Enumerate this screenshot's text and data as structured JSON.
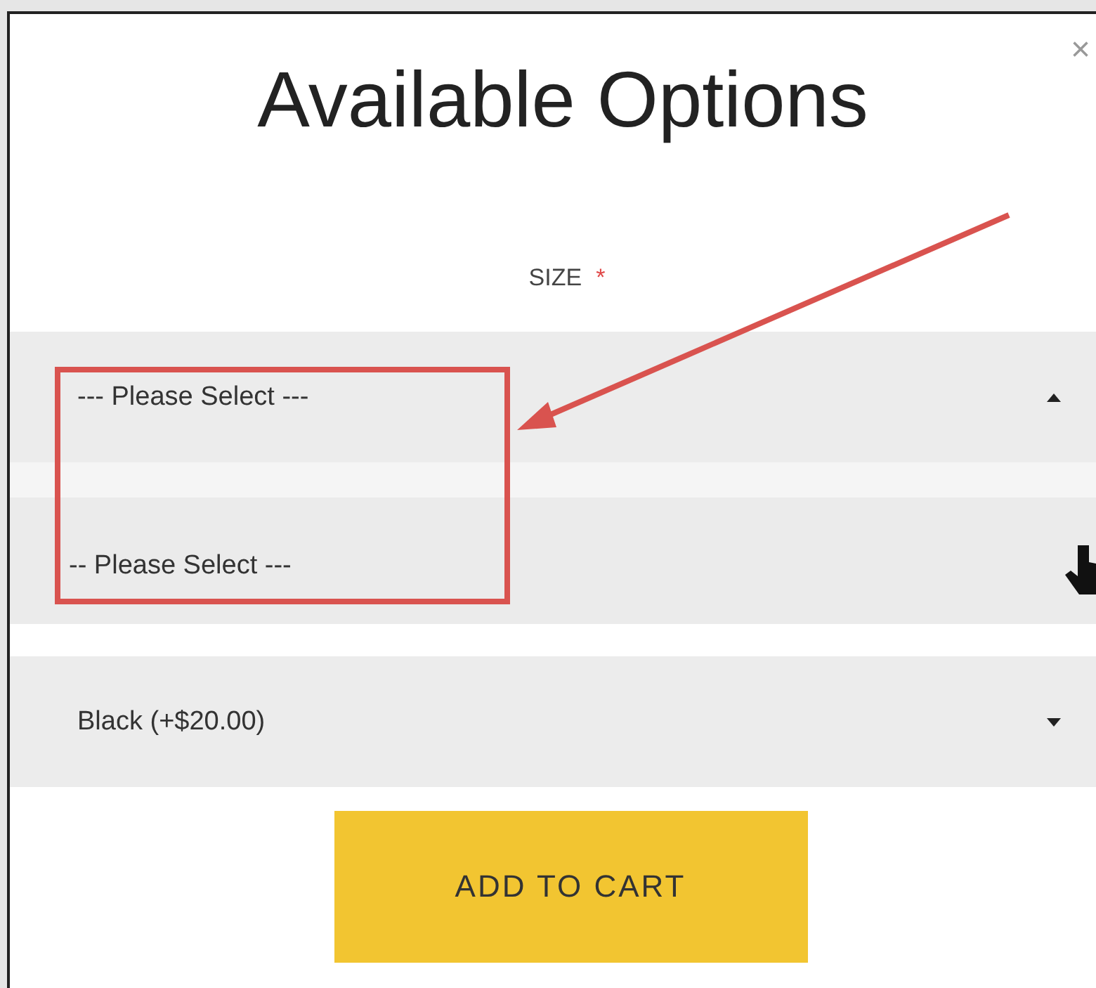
{
  "dialog": {
    "title": "Available Options",
    "close": "×"
  },
  "fields": [
    {
      "label": "SIZE",
      "required_mark": "*",
      "value": "--- Please Select ---",
      "expanded": true,
      "options": [
        {
          "label": "-- Please Select ---",
          "selected": false
        }
      ]
    },
    {
      "value": "Black (+$20.00)",
      "expanded": false
    }
  ],
  "button": {
    "label": "ADD TO CART"
  }
}
